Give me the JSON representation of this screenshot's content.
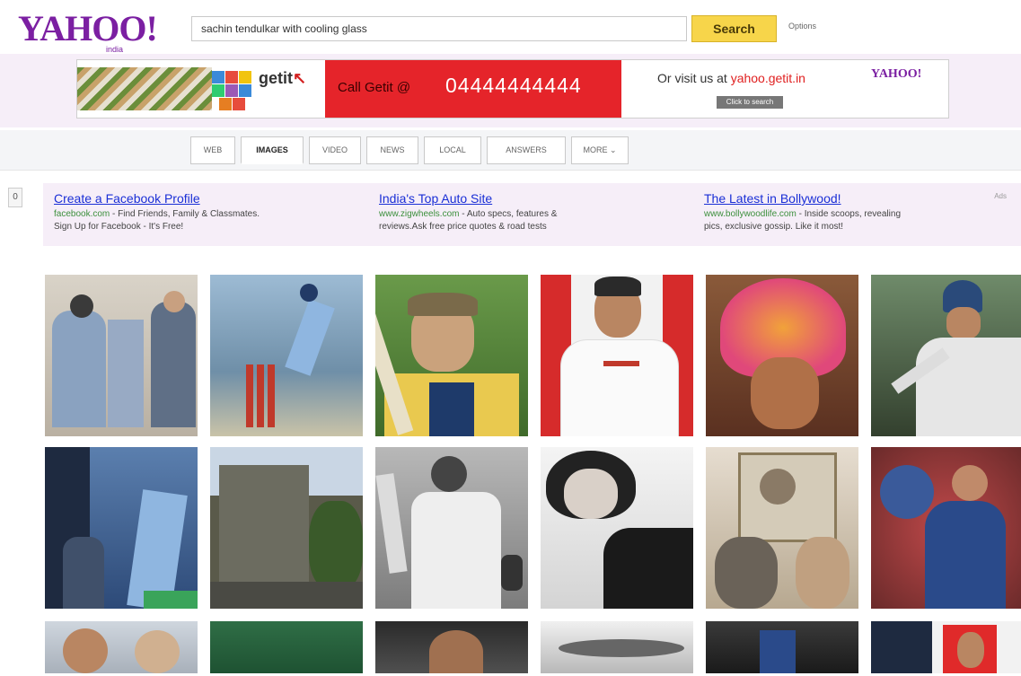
{
  "header": {
    "logo": "YAHOO!",
    "logo_sub": "india",
    "search_value": "sachin tendulkar with cooling glass",
    "search_button": "Search",
    "options_label": "Options"
  },
  "banner": {
    "brand": "getit",
    "call_text": "Call Getit @",
    "phone": "04444444444",
    "visit_text": "Or visit us at",
    "visit_link": "yahoo.getit.in",
    "visit_button": "Click to search",
    "logo": "YAHOO!"
  },
  "tabs": [
    {
      "label": "WEB"
    },
    {
      "label": "IMAGES"
    },
    {
      "label": "VIDEO"
    },
    {
      "label": "NEWS"
    },
    {
      "label": "LOCAL"
    },
    {
      "label": "ANSWERS"
    },
    {
      "label": "MORE ⌄"
    }
  ],
  "active_tab": "IMAGES",
  "ads": {
    "label": "Ads",
    "items": [
      {
        "title": "Create a Facebook Profile",
        "url": "facebook.com",
        "desc1": " - Find Friends, Family & Classmates.",
        "desc2": "Sign Up for Facebook - It's Free!"
      },
      {
        "title": "India's Top Auto Site",
        "url": "www.zigwheels.com",
        "desc1": " - Auto specs, features &",
        "desc2": "reviews.Ask free price quotes & road tests"
      },
      {
        "title": "The Latest in Bollywood!",
        "url": "www.bollywoodlife.com",
        "desc1": " - Inside scoops, revealing",
        "desc2": "pics, exclusive gossip. Like it most!"
      }
    ]
  },
  "side_button": "0",
  "results": [
    {
      "name": "officers-with-man"
    },
    {
      "name": "cricketer-batting-stumps"
    },
    {
      "name": "cricketer-with-bat-and-cap"
    },
    {
      "name": "man-red-white-backdrop"
    },
    {
      "name": "man-in-turban"
    },
    {
      "name": "cricketer-in-helmet"
    },
    {
      "name": "players-celebrating"
    },
    {
      "name": "building-street"
    },
    {
      "name": "batsman-raising-bat-bw"
    },
    {
      "name": "woman-portrait-bw"
    },
    {
      "name": "group-photo-old"
    },
    {
      "name": "cricketer-crowd"
    },
    {
      "name": "two-men-close"
    },
    {
      "name": "green-field"
    },
    {
      "name": "face-dark"
    },
    {
      "name": "bw-curve"
    },
    {
      "name": "cricketer-dark"
    },
    {
      "name": "man-red-frame"
    }
  ]
}
